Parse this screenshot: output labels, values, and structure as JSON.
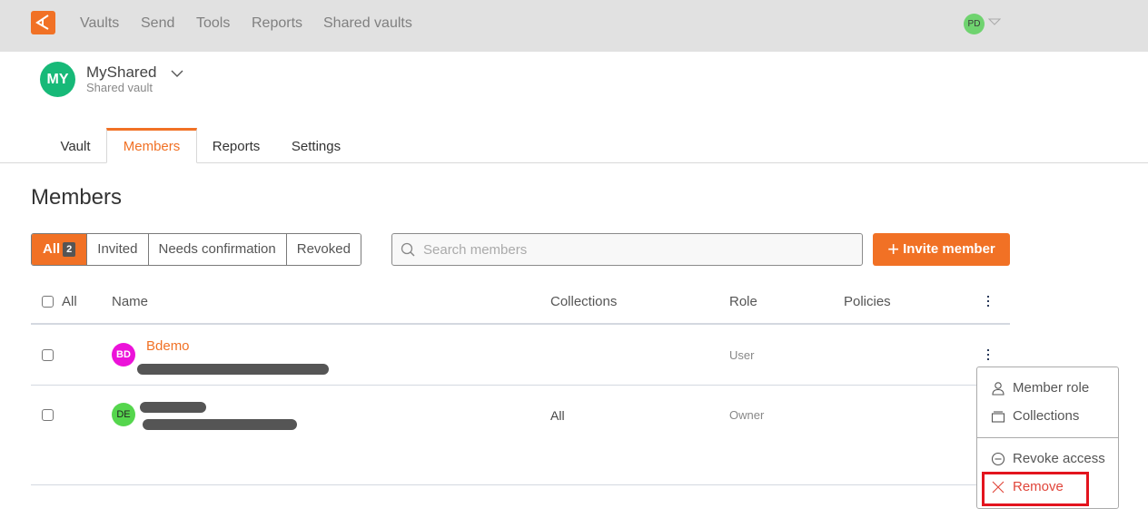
{
  "topbar": {
    "logo": "app-logo-icon",
    "nav": [
      "Vaults",
      "Send",
      "Tools",
      "Reports",
      "Shared vaults"
    ],
    "user_initials": "PD",
    "user_menu_icon": "caret-down-icon"
  },
  "vault": {
    "initials": "MY",
    "name": "MyShared",
    "subtitle": "Shared vault",
    "avatar_color": "#17b978"
  },
  "tabs": [
    {
      "label": "Vault",
      "active": false
    },
    {
      "label": "Members",
      "active": true
    },
    {
      "label": "Reports",
      "active": false
    },
    {
      "label": "Settings",
      "active": false
    }
  ],
  "page": {
    "title": "Members"
  },
  "filters": {
    "all_label": "All",
    "all_count": "2",
    "items": [
      "Invited",
      "Needs confirmation",
      "Revoked"
    ]
  },
  "search": {
    "placeholder": "Search members",
    "value": ""
  },
  "invite_button": {
    "icon": "+",
    "label": "Invite member"
  },
  "table": {
    "select_all_label": "All",
    "columns": [
      "Name",
      "Collections",
      "Role",
      "Policies"
    ],
    "rows": [
      {
        "initials": "BD",
        "avatar_color": "#ec12d9",
        "name": "Bdemo",
        "email": "[redacted]",
        "collections": "",
        "role": "User",
        "policies": ""
      },
      {
        "initials": "DE",
        "avatar_color": "#55d64d",
        "name": "[redacted]",
        "email": "[redacted]",
        "collections": "All",
        "role": "Owner",
        "policies": ""
      }
    ]
  },
  "context_menu": {
    "items": [
      {
        "label": "Member role",
        "icon": "person-icon"
      },
      {
        "label": "Collections",
        "icon": "collection-icon"
      },
      {
        "label": "Revoke access",
        "icon": "minus-circle-icon"
      },
      {
        "label": "Remove",
        "icon": "x-icon",
        "danger": true
      }
    ],
    "highlighted_item": "Remove"
  },
  "colors": {
    "accent": "#f17125",
    "danger": "#e0453a",
    "highlight_box": "#e3141e"
  }
}
